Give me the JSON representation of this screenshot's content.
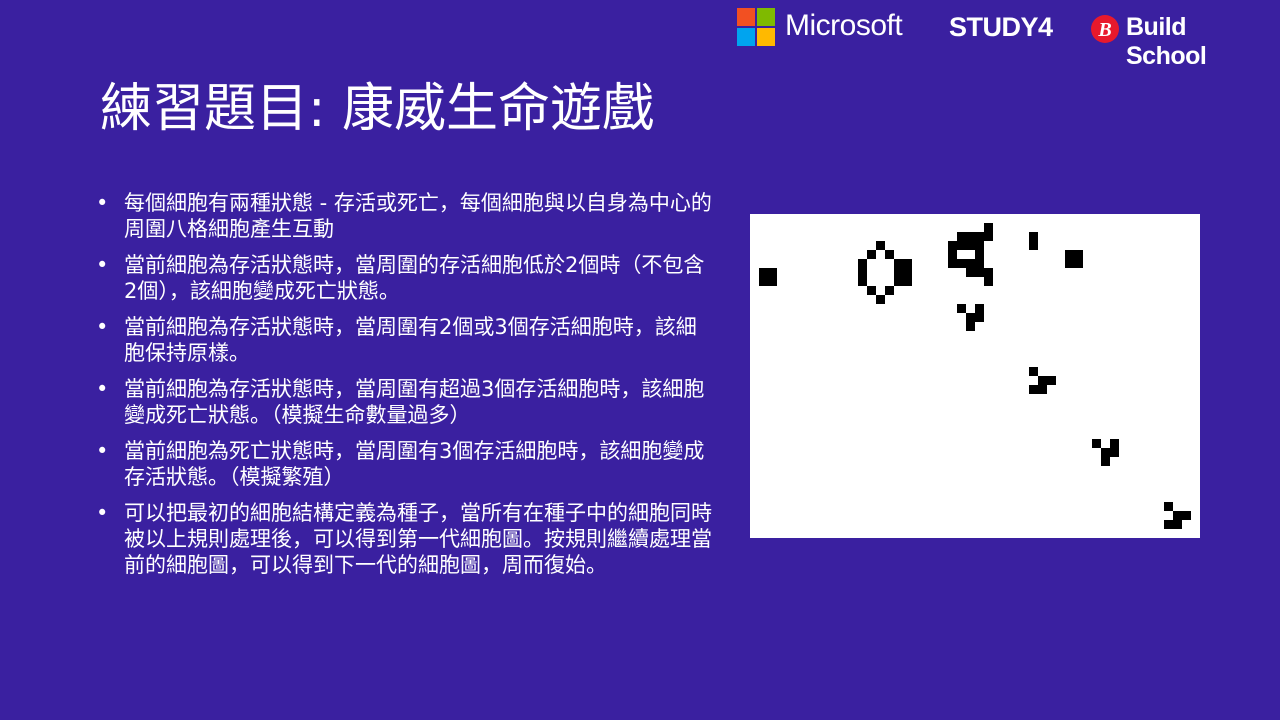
{
  "header": {
    "microsoft_logo_text": "Microsoft",
    "study4_logo_text": "STUDY4",
    "buildschool_logo_text": "Build School",
    "microsoft_colors": [
      "#f25022",
      "#7fba00",
      "#00a4ef",
      "#ffb900"
    ],
    "buildschool_icon_color": "#e8192c"
  },
  "slide": {
    "title": "練習題目: 康威生命遊戲",
    "background_color": "#3a20a0",
    "bullets": [
      "每個細胞有兩種狀態 - 存活或死亡，每個細胞與以自身為中心的周圍八格細胞產生互動",
      "當前細胞為存活狀態時，當周圍的存活細胞低於2個時（不包含2個），該細胞變成死亡狀態。",
      "當前細胞為存活狀態時，當周圍有2個或3個存活細胞時，該細胞保持原樣。",
      "當前細胞為存活狀態時，當周圍有超過3個存活細胞時，該細胞變成死亡狀態。（模擬生命數量過多）",
      "當前細胞為死亡狀態時，當周圍有3個存活細胞時，該細胞變成存活狀態。（模擬繁殖）",
      "可以把最初的細胞結構定義為種子，當所有在種子中的細胞同時被以上規則處理後，可以得到第一代細胞圖。按規則繼續處理當前的細胞圖，可以得到下一代的細胞圖，周而復始。"
    ]
  },
  "game_of_life_board": {
    "background_color": "#ffffff",
    "alive_cell_color": "#000000"
  }
}
